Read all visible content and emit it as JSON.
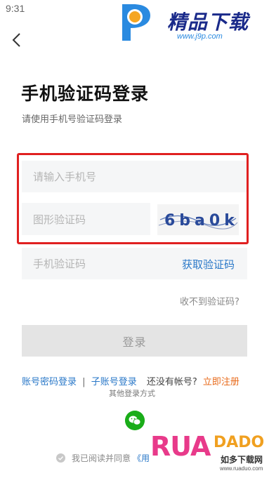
{
  "status_bar": {
    "time": "9:31"
  },
  "watermark_top": {
    "brand": "精品下载",
    "url": "www.j9p.com"
  },
  "header": {
    "title": "手机验证码登录",
    "subtitle": "请使用手机号验证码登录"
  },
  "form": {
    "phone_placeholder": "请输入手机号",
    "captcha_placeholder": "图形验证码",
    "captcha_image_text": "6ba0k",
    "sms_placeholder": "手机验证码",
    "get_code_label": "获取验证码",
    "no_code_label": "收不到验证码?",
    "login_label": "登录"
  },
  "alt_links": {
    "password_login": "账号密码登录",
    "separator": "|",
    "sub_account_login": "子账号登录",
    "no_account": "还没有帐号?",
    "register": "立即注册"
  },
  "other_methods_label": "其他登录方式",
  "agreement": {
    "prefix": "我已阅读并同意",
    "link": "《用"
  },
  "watermark_bottom": {
    "rua": "RUA",
    "dado": "DADO",
    "cn": "如多下载网",
    "url": "www.ruaduo.com"
  },
  "colors": {
    "accent": "#2a78c8",
    "register": "#e86a1a",
    "highlight": "#e02020",
    "wechat": "#1aad19"
  }
}
